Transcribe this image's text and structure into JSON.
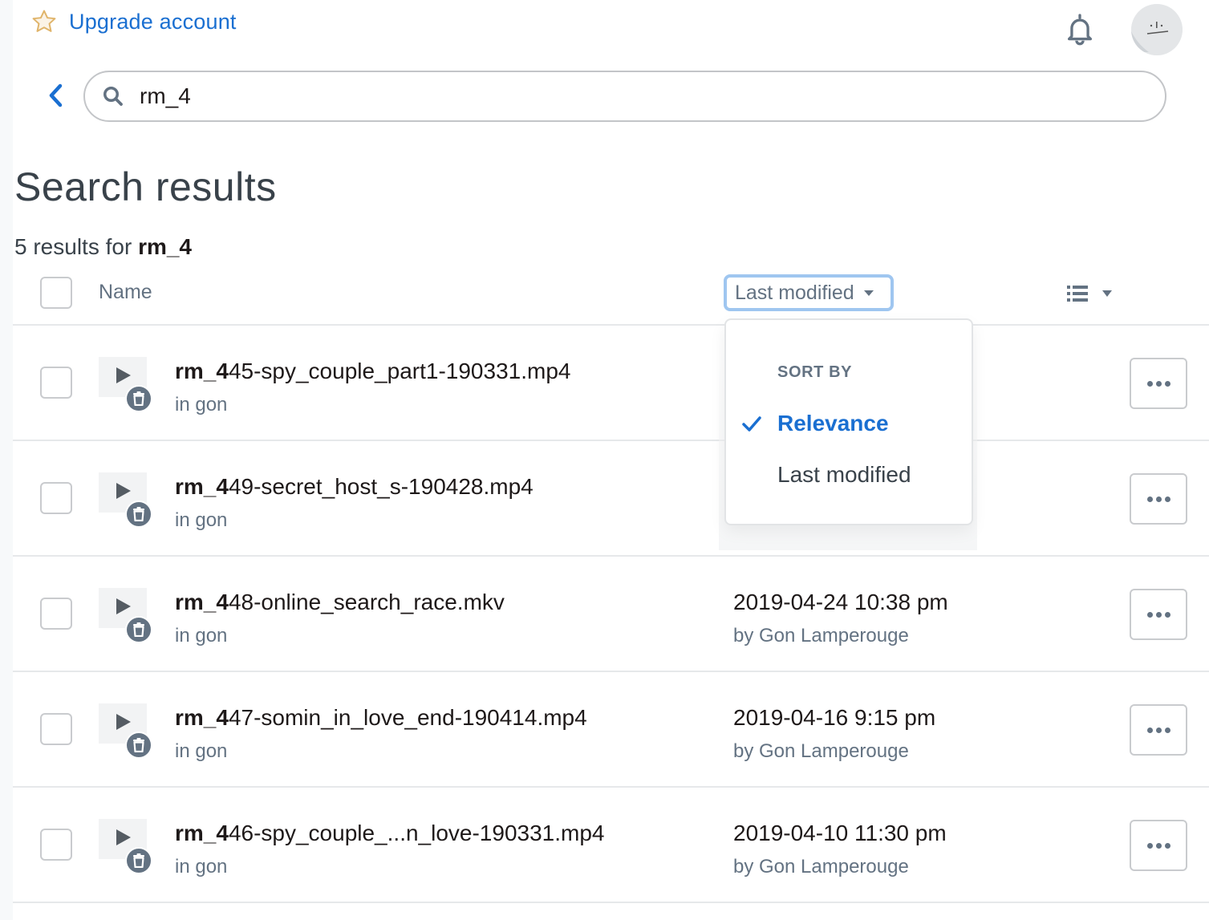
{
  "header": {
    "upgrade_label": "Upgrade account",
    "icons": {
      "upgrade": "star-icon",
      "notifications": "bell-icon",
      "profile": "avatar"
    }
  },
  "search": {
    "query": "rm_4",
    "back_icon": "chevron-left-icon",
    "search_icon": "magnifier-icon"
  },
  "page": {
    "title": "Search results",
    "result_count_prefix": "5 results for",
    "result_count_query": "rm_4"
  },
  "table": {
    "columns": {
      "name": "Name",
      "sort_label": "Last modified"
    },
    "view_icon": "list-view-icon",
    "rows": [
      {
        "name_match": "rm_4",
        "name_rest": "45-spy_couple_part1-190331.mp4",
        "location": "in gon",
        "modified": "",
        "modified_by": ""
      },
      {
        "name_match": "rm_4",
        "name_rest": "49-secret_host_s-190428.mp4",
        "location": "in gon",
        "modified": "",
        "modified_by": ""
      },
      {
        "name_match": "rm_4",
        "name_rest": "48-online_search_race.mkv",
        "location": "in gon",
        "modified": "2019-04-24 10:38 pm",
        "modified_by": "by Gon Lamperouge"
      },
      {
        "name_match": "rm_4",
        "name_rest": "47-somin_in_love_end-190414.mp4",
        "location": "in gon",
        "modified": "2019-04-16 9:15 pm",
        "modified_by": "by Gon Lamperouge"
      },
      {
        "name_match": "rm_4",
        "name_rest": "46-spy_couple_...n_love-190331.mp4",
        "location": "in gon",
        "modified": "2019-04-10 11:30 pm",
        "modified_by": "by Gon Lamperouge"
      }
    ]
  },
  "sort_dropdown": {
    "heading": "SORT BY",
    "options": [
      {
        "label": "Relevance",
        "selected": true
      },
      {
        "label": "Last modified",
        "selected": false
      }
    ]
  },
  "colors": {
    "accent": "#1a6fd1",
    "muted": "#637282",
    "focus_ring": "#9fc6f0",
    "star": "#e0b46a"
  }
}
